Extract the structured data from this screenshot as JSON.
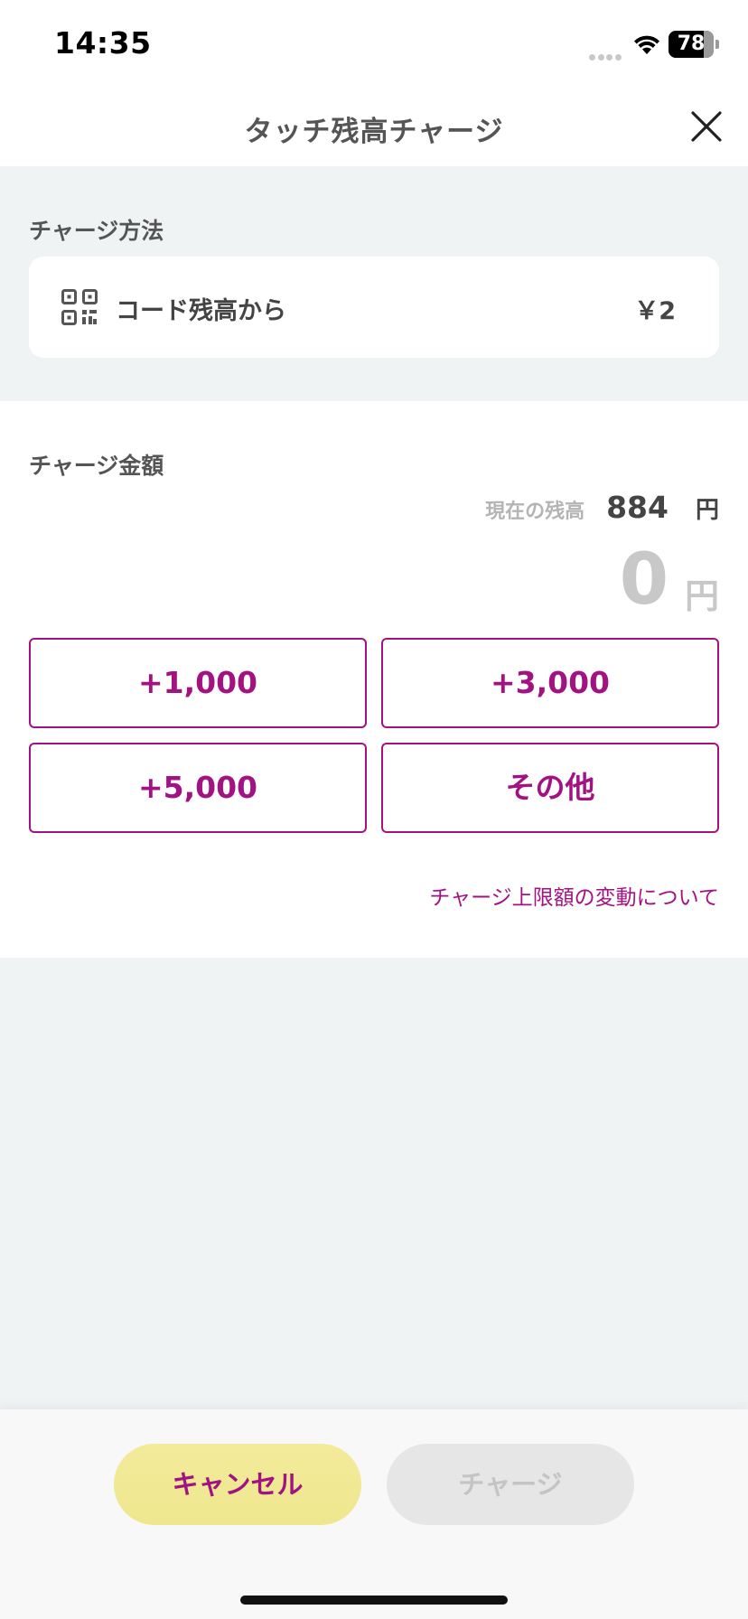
{
  "status_bar": {
    "time": "14:35",
    "battery": "78",
    "icons": [
      "signal-dots-icon",
      "wifi-icon",
      "battery-icon"
    ]
  },
  "header": {
    "title": "タッチ残高チャージ",
    "close_icon": "close-icon"
  },
  "method": {
    "label": "チャージ方法",
    "icon": "qr-code-icon",
    "name": "コード残高から",
    "balance": "￥2"
  },
  "amount": {
    "label": "チャージ金額",
    "current_label": "現在の残高",
    "current_value": "884",
    "current_unit": "円",
    "charge_value": "0",
    "charge_unit": "円",
    "buttons": [
      "+1,000",
      "+3,000",
      "+5,000",
      "その他"
    ],
    "limit_link": "チャージ上限額の変動について"
  },
  "footer": {
    "cancel_label": "キャンセル",
    "charge_label": "チャージ"
  },
  "colors": {
    "accent": "#a31282",
    "cancel_bg": "#f0e890",
    "disabled_bg": "#e6e6e6",
    "page_bg": "#eff3f4"
  }
}
